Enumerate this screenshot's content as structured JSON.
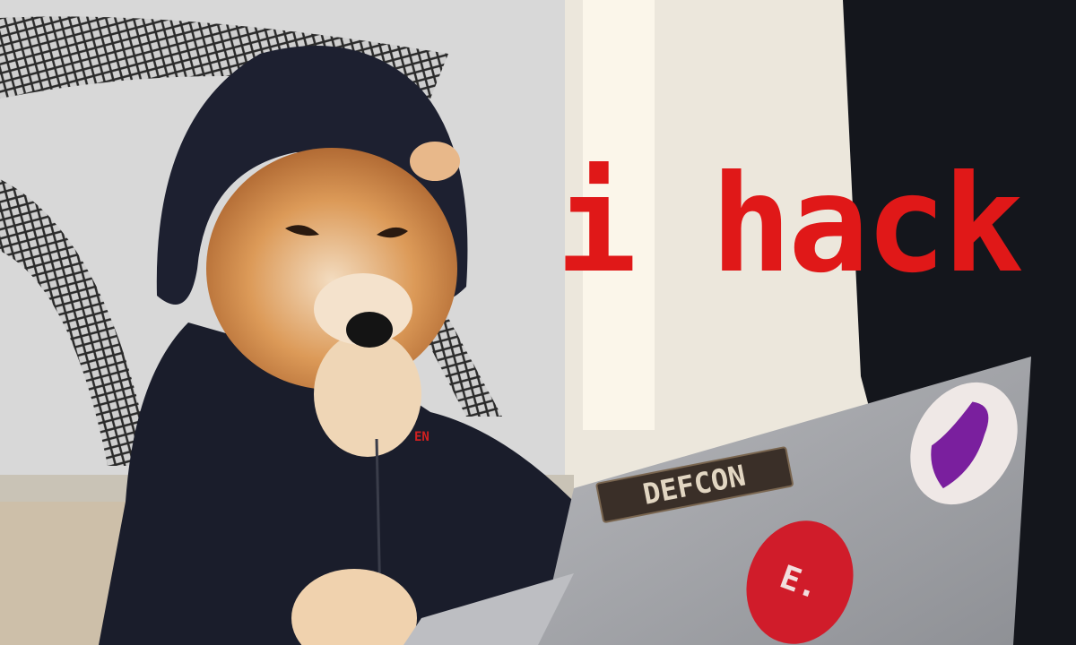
{
  "caption": "i hack",
  "stickers": {
    "defcon": "DEFCON",
    "red_logo": "E.",
    "purple_logo": "purple-figure-sticker"
  },
  "hoodie_logo": "EN",
  "colors": {
    "caption_red": "#e01818",
    "hoodie": "#1a1d2b",
    "fur": "#d9934e",
    "laptop": "#a9aaae",
    "wall": "#ece7dc",
    "dark_panel": "#14161c"
  }
}
